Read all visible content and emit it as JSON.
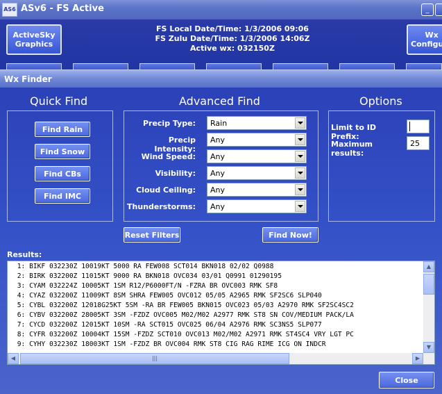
{
  "app": {
    "icon_text": "AS6",
    "title": "ASv6 - FS Active",
    "buttons": {
      "graphics": "ActiveSky Graphics",
      "configure": "Wx Configure"
    },
    "fs_info": {
      "local": "FS Local Date/Time: 1/3/2006 09:06",
      "zulu": "FS Zulu Date/Time: 1/3/2006 14:06Z",
      "active_wx": "Active wx: 032150Z"
    }
  },
  "dialog": {
    "title": "Wx Finder",
    "quick_find": {
      "heading": "Quick Find",
      "buttons": [
        "Find Rain",
        "Find Snow",
        "Find CBs",
        "Find IMC"
      ]
    },
    "advanced_find": {
      "heading": "Advanced Find",
      "filters": [
        {
          "label": "Precip Type:",
          "value": "Rain"
        },
        {
          "label": "Precip Intensity:",
          "value": "Any"
        },
        {
          "label": "Wind Speed:",
          "value": "Any"
        },
        {
          "label": "Visibility:",
          "value": "Any"
        },
        {
          "label": "Cloud Ceiling:",
          "value": "Any"
        },
        {
          "label": "Thunderstorms:",
          "value": "Any"
        }
      ],
      "reset_label": "Reset Filters",
      "find_now_label": "Find Now!"
    },
    "options": {
      "heading": "Options",
      "prefix_label": "Limit to ID Prefix:",
      "prefix_value": "",
      "max_label": "Maximum results:",
      "max_value": "25"
    },
    "results": {
      "label": "Results:",
      "lines": [
        " 1: BIKF 032230Z 10019KT 5000 RA FEW008 SCT014 BKN018 02/02 Q0988",
        " 2: BIRK 032200Z 11015KT 9000 RA BKN018 OVC034 03/01 Q0991 01290195",
        " 3: CYAM 032224Z 10005KT 1SM R12/P6000FT/N -FZRA BR OVC003 RMK SF8",
        " 4: CYAZ 032200Z 11009KT 8SM SHRA FEW005 OVC012 05/05 A2965 RMK SF2SC6 SLP040",
        " 5: CYBL 032200Z 12018G25KT 5SM -RA BR FEW005 BKN015 OVC023 05/03 A2970 RMK SF2SC4SC2",
        " 6: CYBV 032200Z 28005KT 3SM -FZDZ OVC005 M02/M02 A2977 RMK ST8 SN COV/MEDIUM PACK/LA",
        " 7: CYCD 032200Z 12015KT 10SM -RA SCT015 OVC025 06/04 A2976 RMK SC3NS5 SLP077",
        " 8: CYFR 032200Z 10004KT 15SM -FZDZ SCT010 OVC013 M02/M02 A2971 RMK ST4SC4 VRY LGT PC",
        " 9: CYHY 032230Z 18003KT 1SM -FZDZ BR OVC004 RMK ST8 CIG RAG RIME ICG ON INDCR"
      ]
    },
    "close_label": "Close"
  },
  "colors": {
    "background": "#2036a4",
    "button": "#4a68dc",
    "title_bar": "#7088d6"
  }
}
